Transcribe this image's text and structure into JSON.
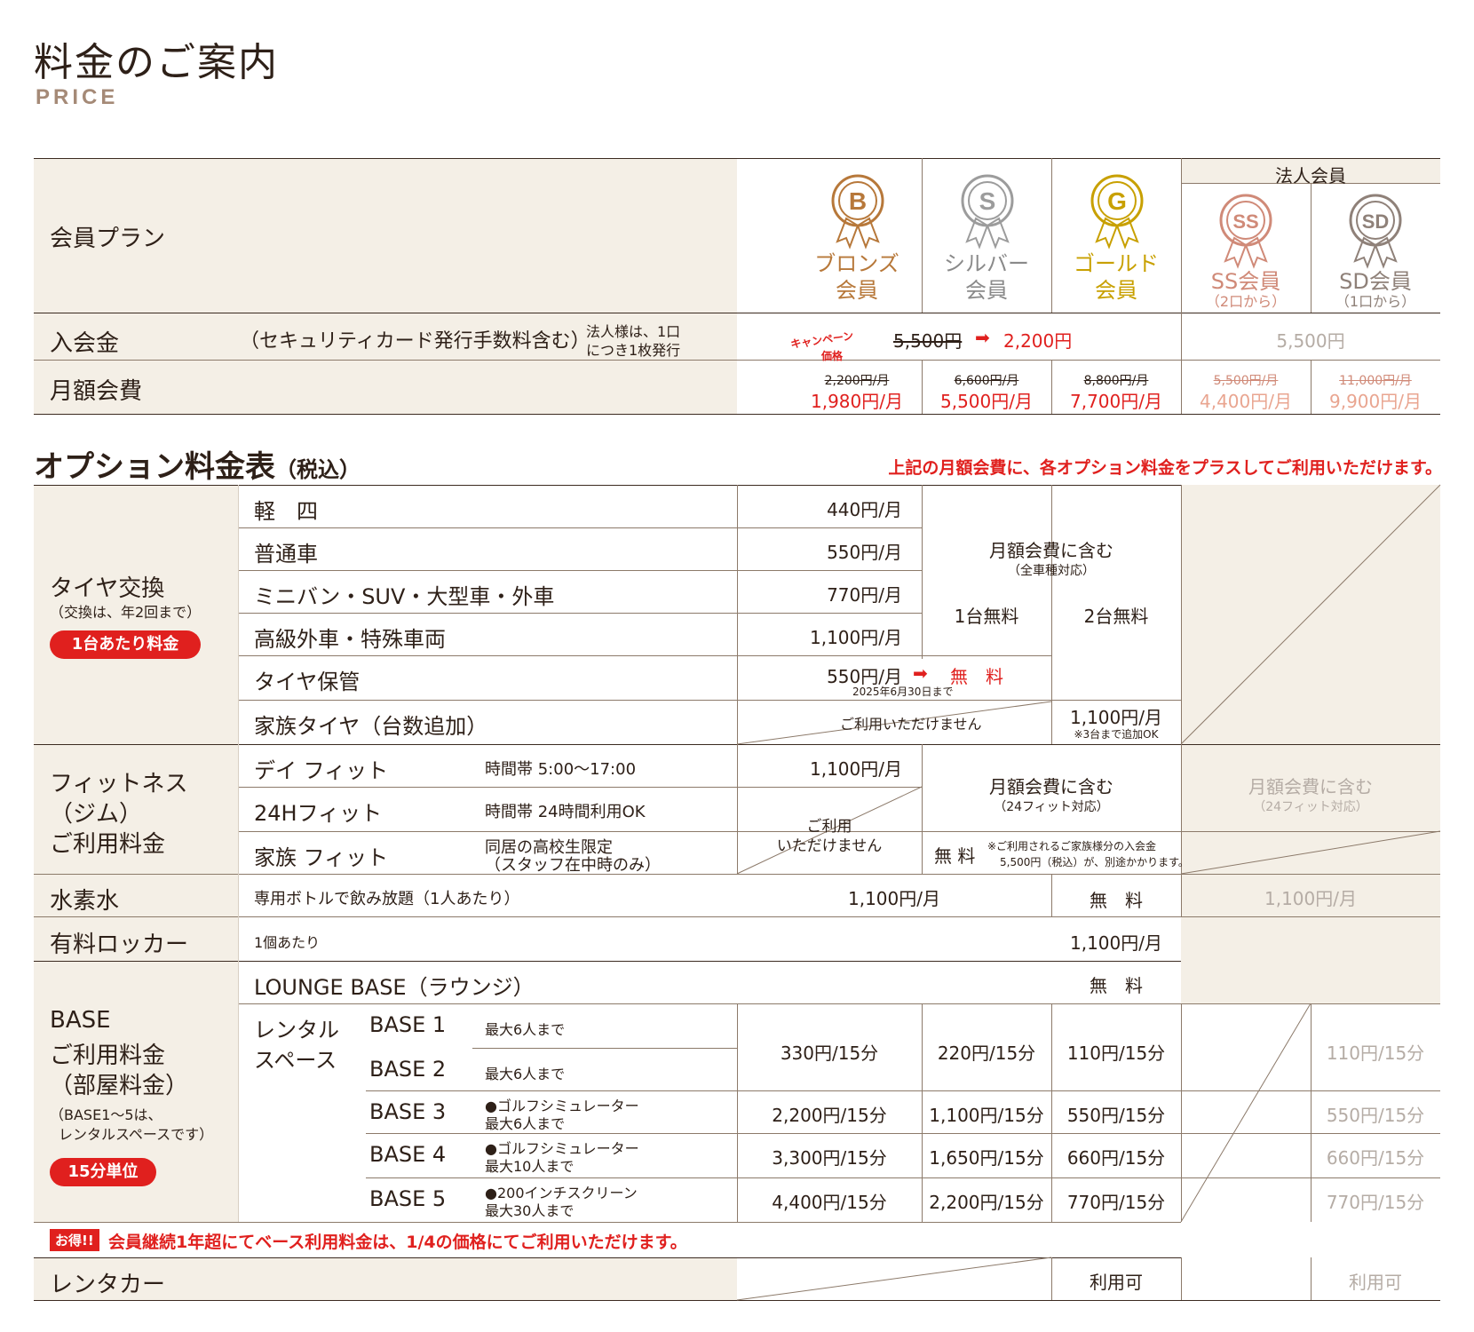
{
  "header": {
    "title": "料金のご案内",
    "subtitle": "PRICE"
  },
  "colors": {
    "bronze": "#b7783a",
    "silver": "#9c9c9c",
    "gold": "#c8a000",
    "corp": "#d08a78",
    "red": "#e0201e"
  },
  "membership": {
    "plan_label": "会員プラン",
    "corp_header": "法人会員",
    "plans": [
      {
        "icon": "bronze-medal-icon",
        "letter": "B",
        "name1": "ブロンズ",
        "name2": "会員"
      },
      {
        "icon": "silver-medal-icon",
        "letter": "S",
        "name1": "シルバー",
        "name2": "会員"
      },
      {
        "icon": "gold-medal-icon",
        "letter": "G",
        "name1": "ゴールド",
        "name2": "会員"
      },
      {
        "icon": "ss-medal-icon",
        "letter": "SS",
        "name1": "SS会員",
        "name2": "（2口から）"
      },
      {
        "icon": "sd-medal-icon",
        "letter": "SD",
        "name1": "SD会員",
        "name2": "（1口から）"
      }
    ],
    "entry_fee": {
      "label": "入会金",
      "note": "（セキュリティカード発行手数料含む）",
      "corp_note1": "法人様は、1口",
      "corp_note2": "につき1枚発行",
      "campaign1": "キャンペーン",
      "campaign2": "価格",
      "old_price": "5,500円",
      "new_price": "2,200円",
      "corp_price": "5,500円"
    },
    "monthly_fee": {
      "label": "月額会費",
      "prices": [
        {
          "old": "2,200円/月",
          "new": "1,980円/月"
        },
        {
          "old": "6,600円/月",
          "new": "5,500円/月"
        },
        {
          "old": "8,800円/月",
          "new": "7,700円/月"
        },
        {
          "old": "5,500円/月",
          "new": "4,400円/月"
        },
        {
          "old": "11,000円/月",
          "new": "9,900円/月"
        }
      ]
    }
  },
  "options": {
    "title": "オプション料金表",
    "title_suffix": "（税込）",
    "notice": "上記の月額会費に、各オプション料金をプラスしてご利用いただけます。",
    "tire": {
      "label": "タイヤ交換",
      "sub": "（交換は、年2回まで）",
      "pill": "1台あたり料金",
      "rows": [
        {
          "name": "軽　四",
          "price": "440円/月"
        },
        {
          "name": "普通車",
          "price": "550円/月"
        },
        {
          "name": "ミニバン・SUV・大型車・外車",
          "price": "770円/月"
        },
        {
          "name": "高級外車・特殊車両",
          "price": "1,100円/月"
        },
        {
          "name": "タイヤ保管",
          "price": "550円/月"
        },
        {
          "name": "家族タイヤ（台数追加）",
          "price": ""
        }
      ],
      "included": "月額会費に含む",
      "included_sub": "（全車種対応）",
      "silver_free": "1台無料",
      "gold_free": "2台無料",
      "storage_free": "無　料",
      "storage_until": "2025年6月30日まで",
      "family_unavailable": "ご利用いただけません",
      "family_gold": "1,100円/月",
      "family_gold_note": "※3台まで追加OK"
    },
    "fitness": {
      "label1": "フィットネス",
      "label2": "（ジム）",
      "label3": "ご利用料金",
      "rows": [
        {
          "name": "デイ フィット",
          "desc": "時間帯 5:00〜17:00",
          "price": "1,100円/月"
        },
        {
          "name": "24Hフィット",
          "desc": "時間帯 24時間利用OK",
          "price": ""
        },
        {
          "name": "家族 フィット",
          "desc": "同居の高校生限定",
          "desc2": "（スタッフ在中時のみ）",
          "price": ""
        }
      ],
      "unavailable1": "ご利用",
      "unavailable2": "いただけません",
      "included": "月額会費に含む",
      "included_sub": "（24フィット対応）",
      "family_free": "無 料",
      "family_note1": "※ご利用されるご家族様分の入会金",
      "family_note2": "5,500円（税込）が、別途かかります。",
      "corp_included": "月額会費に含む",
      "corp_included_sub": "（24フィット対応）"
    },
    "hydrogen": {
      "label": "水素水",
      "desc": "専用ボトルで飲み放題（1人あたり）",
      "price": "1,100円/月",
      "gold": "無　料",
      "corp": "1,100円/月"
    },
    "locker": {
      "label": "有料ロッカー",
      "desc": "1個あたり",
      "price": "1,100円/月"
    },
    "base": {
      "label1": "BASE",
      "label2": "ご利用料金",
      "label3": "（部屋料金）",
      "sub1": "（BASE1〜5は、",
      "sub2": "レンタルスペースです）",
      "pill": "15分単位",
      "lounge": "LOUNGE BASE（ラウンジ）",
      "lounge_price": "無　料",
      "rental1": "レンタル",
      "rental2": "スペース",
      "rows": [
        {
          "name": "BASE 1",
          "desc": "最大6人まで",
          "desc2": ""
        },
        {
          "name": "BASE 2",
          "desc": "最大6人まで",
          "desc2": ""
        },
        {
          "name": "BASE 3",
          "desc": "●ゴルフシミュレーター",
          "desc2": "最大6人まで",
          "b": "2,200円/15分",
          "s": "1,100円/15分",
          "g": "550円/15分",
          "c": "550円/15分"
        },
        {
          "name": "BASE 4",
          "desc": "●ゴルフシミュレーター",
          "desc2": "最大10人まで",
          "b": "3,300円/15分",
          "s": "1,650円/15分",
          "g": "660円/15分",
          "c": "660円/15分"
        },
        {
          "name": "BASE 5",
          "desc": "●200インチスクリーン",
          "desc2": "最大30人まで",
          "b": "4,400円/15分",
          "s": "2,200円/15分",
          "g": "770円/15分",
          "c": "770円/15分"
        }
      ],
      "b12": "330円/15分",
      "s12": "220円/15分",
      "g12": "110円/15分",
      "c12": "110円/15分"
    },
    "deal_badge": "お得!!",
    "deal_text": "会員継続1年超にてベース利用料金は、1/4の価格にてご利用いただけます。",
    "rentacar": {
      "label": "レンタカー",
      "gold": "利用可",
      "corp": "利用可"
    }
  }
}
